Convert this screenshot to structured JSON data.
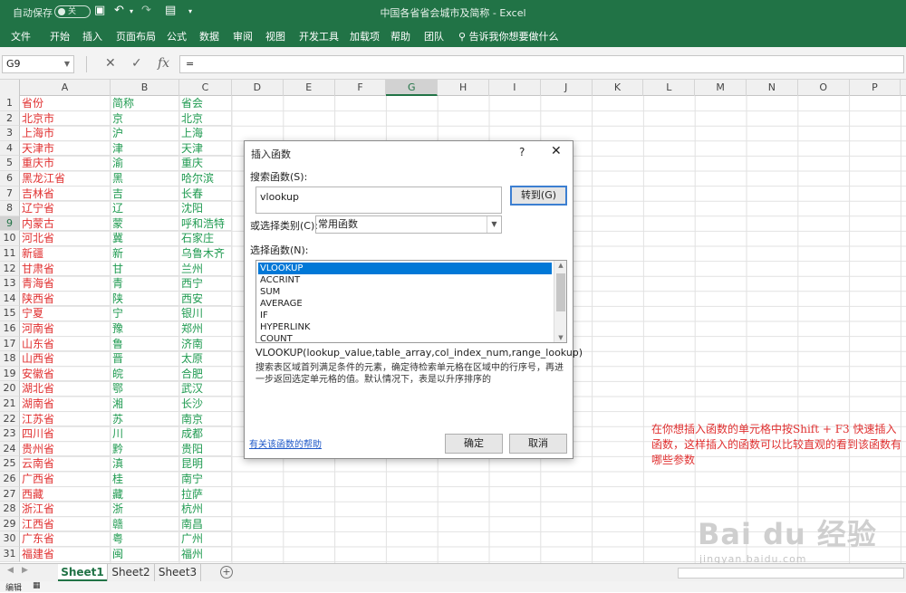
{
  "titlebar": {
    "autosave_label": "自动保存",
    "autosave_state": "关",
    "window_title": "中国各省省会城市及简称  -  Excel"
  },
  "ribbon": {
    "tabs": [
      "文件",
      "开始",
      "插入",
      "页面布局",
      "公式",
      "数据",
      "审阅",
      "视图",
      "开发工具",
      "加载项",
      "帮助",
      "团队"
    ],
    "tell_me": "告诉我你想要做什么"
  },
  "formula_bar": {
    "name_box": "G9",
    "formula": "="
  },
  "sheet": {
    "columns": [
      "A",
      "B",
      "C",
      "D",
      "E",
      "F",
      "G",
      "H",
      "I",
      "J",
      "K",
      "L",
      "M",
      "N",
      "O",
      "P"
    ],
    "selected_column": "G",
    "selected_row": 9,
    "rows": [
      {
        "n": "1",
        "a": "省份",
        "b": "简称",
        "c": "省会"
      },
      {
        "n": "2",
        "a": "北京市",
        "b": "京",
        "c": "北京"
      },
      {
        "n": "3",
        "a": "上海市",
        "b": "沪",
        "c": "上海"
      },
      {
        "n": "4",
        "a": "天津市",
        "b": "津",
        "c": "天津"
      },
      {
        "n": "5",
        "a": "重庆市",
        "b": "渝",
        "c": "重庆"
      },
      {
        "n": "6",
        "a": "黑龙江省",
        "b": "黑",
        "c": "哈尔滨"
      },
      {
        "n": "7",
        "a": "吉林省",
        "b": "吉",
        "c": "长春"
      },
      {
        "n": "8",
        "a": "辽宁省",
        "b": "辽",
        "c": "沈阳"
      },
      {
        "n": "9",
        "a": "内蒙古",
        "b": "蒙",
        "c": "呼和浩特"
      },
      {
        "n": "10",
        "a": "河北省",
        "b": "冀",
        "c": "石家庄"
      },
      {
        "n": "11",
        "a": "新疆",
        "b": "新",
        "c": "乌鲁木齐"
      },
      {
        "n": "12",
        "a": "甘肃省",
        "b": "甘",
        "c": "兰州"
      },
      {
        "n": "13",
        "a": "青海省",
        "b": "青",
        "c": "西宁"
      },
      {
        "n": "14",
        "a": "陕西省",
        "b": "陕",
        "c": "西安"
      },
      {
        "n": "15",
        "a": "宁夏",
        "b": "宁",
        "c": "银川"
      },
      {
        "n": "16",
        "a": "河南省",
        "b": "豫",
        "c": "郑州"
      },
      {
        "n": "17",
        "a": "山东省",
        "b": "鲁",
        "c": "济南"
      },
      {
        "n": "18",
        "a": "山西省",
        "b": "晋",
        "c": "太原"
      },
      {
        "n": "19",
        "a": "安徽省",
        "b": "皖",
        "c": "合肥"
      },
      {
        "n": "20",
        "a": "湖北省",
        "b": "鄂",
        "c": "武汉"
      },
      {
        "n": "21",
        "a": "湖南省",
        "b": "湘",
        "c": "长沙"
      },
      {
        "n": "22",
        "a": "江苏省",
        "b": "苏",
        "c": "南京"
      },
      {
        "n": "23",
        "a": "四川省",
        "b": "川",
        "c": "成都"
      },
      {
        "n": "24",
        "a": "贵州省",
        "b": "黔",
        "c": "贵阳"
      },
      {
        "n": "25",
        "a": "云南省",
        "b": "滇",
        "c": "昆明"
      },
      {
        "n": "26",
        "a": "广西省",
        "b": "桂",
        "c": "南宁"
      },
      {
        "n": "27",
        "a": "西藏",
        "b": "藏",
        "c": "拉萨"
      },
      {
        "n": "28",
        "a": "浙江省",
        "b": "浙",
        "c": "杭州"
      },
      {
        "n": "29",
        "a": "江西省",
        "b": "赣",
        "c": "南昌"
      },
      {
        "n": "30",
        "a": "广东省",
        "b": "粤",
        "c": "广州"
      },
      {
        "n": "31",
        "a": "福建省",
        "b": "闽",
        "c": "福州"
      }
    ]
  },
  "dialog": {
    "title": "插入函数",
    "help": "?",
    "close": "✕",
    "search_label": "搜索函数(S):",
    "search_value": "vlookup",
    "goto_label": "转到(G)",
    "category_label": "或选择类别(C):",
    "category_value": "常用函数",
    "select_label": "选择函数(N):",
    "functions": [
      "VLOOKUP",
      "ACCRINT",
      "SUM",
      "AVERAGE",
      "IF",
      "HYPERLINK",
      "COUNT"
    ],
    "selected_function": "VLOOKUP",
    "signature": "VLOOKUP(lookup_value,table_array,col_index_num,range_lookup)",
    "description": "搜索表区域首列满足条件的元素，确定待检索单元格在区域中的行序号，再进一步返回选定单元格的值。默认情况下，表是以升序排序的",
    "help_link": "有关该函数的帮助",
    "ok_label": "确定",
    "cancel_label": "取消"
  },
  "annotation": "在你想插入函数的单元格中按Shift + F3 快速插入函数，这样插入的函数可以比较直观的看到该函数有哪些参数",
  "watermark": {
    "line1": "Bai du 经验",
    "line2": "jingyan.baidu.com"
  },
  "sheet_tabs": [
    "Sheet1",
    "Sheet2",
    "Sheet3"
  ],
  "active_sheet": "Sheet1",
  "status": {
    "mode": "编辑"
  },
  "colors": {
    "excel_green": "#217346",
    "province_red": "#e03030",
    "abbr_green": "#1f9a50",
    "accent_blue": "#0078d7"
  }
}
